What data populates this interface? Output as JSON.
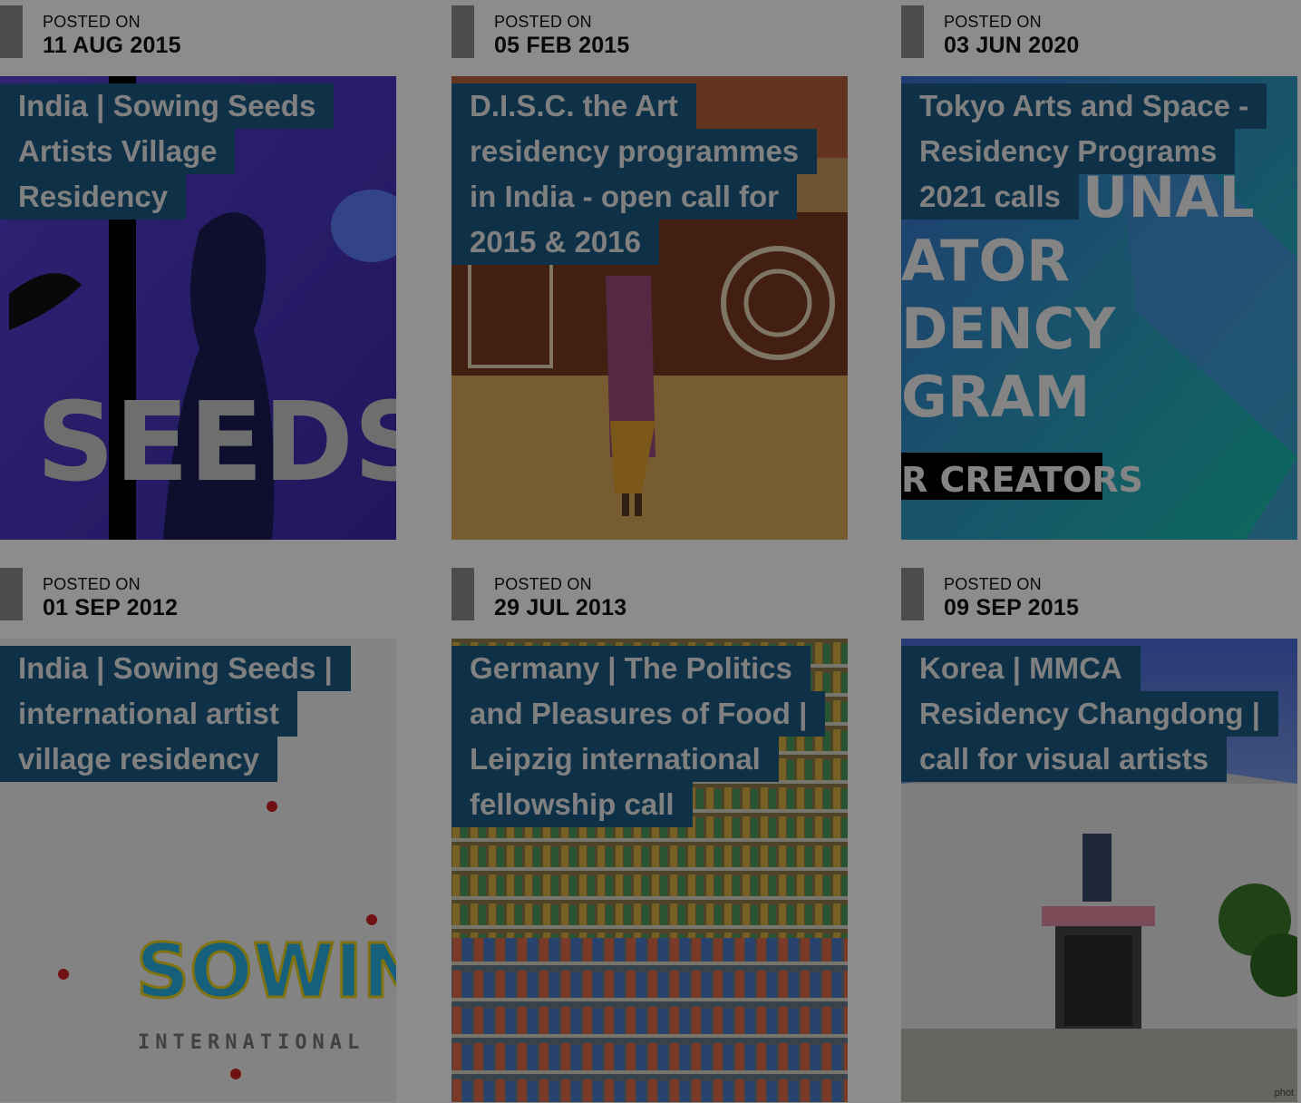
{
  "posts": [
    {
      "posted_label": "POSTED ON",
      "date": "11 AUG 2015",
      "title_lines": [
        "India | Sowing Seeds",
        "Artists Village",
        "Residency"
      ],
      "image": "sowing-seeds-projection-image"
    },
    {
      "posted_label": "POSTED ON",
      "date": "05 FEB 2015",
      "title_lines": [
        "D.I.S.C. the Art",
        "residency programmes",
        "in India - open call for",
        "2015 & 2016"
      ],
      "image": "village-house-image"
    },
    {
      "posted_label": "POSTED ON",
      "date": "03 JUN 2020",
      "title_lines": [
        "Tokyo Arts and Space -",
        "Residency Programs",
        "2021 calls"
      ],
      "image": "creator-residency-poster-image",
      "poster_text": [
        "UNAL",
        "ATOR",
        "DENCY",
        "GRAM",
        "R CREATORS"
      ]
    },
    {
      "posted_label": "POSTED ON",
      "date": "01 SEP 2012",
      "title_lines": [
        "India | Sowing Seeds |",
        "international artist",
        "village residency"
      ],
      "image": "sowing-international-logo-image",
      "logo_text": [
        "SOWING",
        "INTERNATIONAL"
      ]
    },
    {
      "posted_label": "POSTED ON",
      "date": "29 JUL 2013",
      "title_lines": [
        "Germany | The Politics",
        "and Pleasures of Food |",
        "Leipzig international",
        "fellowship call"
      ],
      "image": "supermarket-shelves-image"
    },
    {
      "posted_label": "POSTED ON",
      "date": "09 SEP 2015",
      "title_lines": [
        "Korea | MMCA",
        "Residency Changdong |",
        "call for visual artists"
      ],
      "image": "residency-building-image",
      "credit_text": "phot"
    }
  ],
  "colors": {
    "title_bg": "#1b5a82",
    "overlay": "rgba(0,0,0,0.45)"
  }
}
